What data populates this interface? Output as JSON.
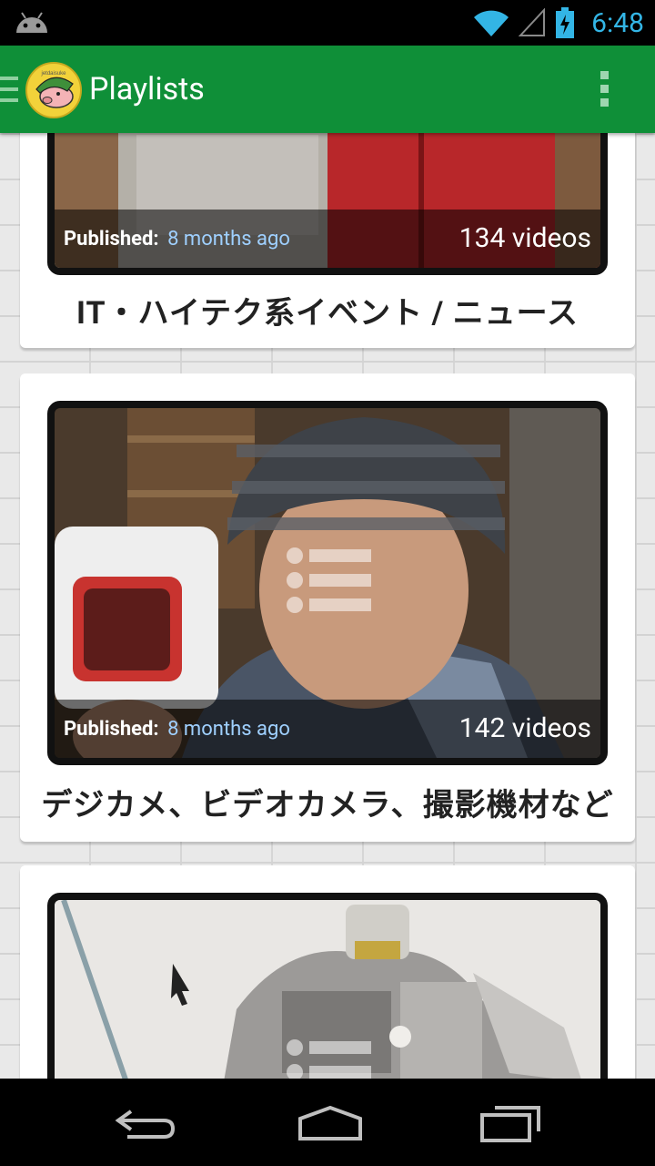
{
  "status_bar": {
    "time": "6:48",
    "icons": [
      "android-debug-icon",
      "wifi-icon",
      "signal-icon",
      "battery-charging-icon"
    ]
  },
  "action_bar": {
    "title": "Playlists",
    "logo_text": "jetdaisuke",
    "icons": [
      "drawer-icon",
      "overflow-menu-icon"
    ]
  },
  "playlists": [
    {
      "published_label": "Published:",
      "published_ago": "8 months ago",
      "video_count": "134 videos",
      "title": "IT・ハイテク系イベント / ニュース"
    },
    {
      "published_label": "Published:",
      "published_ago": "8 months ago",
      "video_count": "142 videos",
      "title": "デジカメ、ビデオカメラ、撮影機材など"
    },
    {
      "published_label": "",
      "published_ago": "",
      "video_count": "",
      "title": ""
    }
  ],
  "nav_bar": {
    "buttons": [
      "back-icon",
      "home-icon",
      "recent-apps-icon"
    ]
  },
  "colors": {
    "action_bar": "#0f8f38",
    "clock": "#33b5e5",
    "published_ago": "#9fd0ff"
  }
}
